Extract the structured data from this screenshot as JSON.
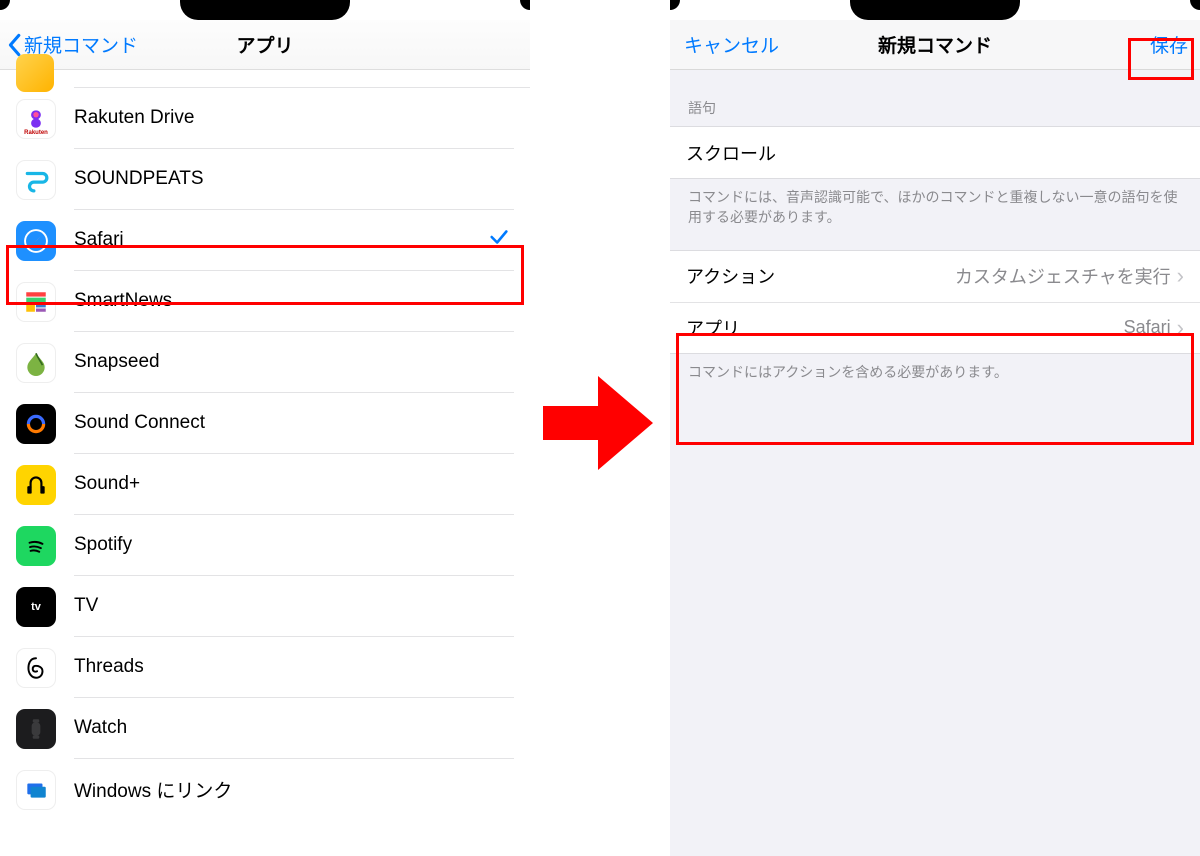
{
  "left": {
    "back_label": "新規コマンド",
    "title": "アプリ",
    "apps": [
      {
        "name": "Rakuten Drive",
        "icon": "rakuten-drive-icon",
        "selected": false
      },
      {
        "name": "SOUNDPEATS",
        "icon": "soundpeats-icon",
        "selected": false
      },
      {
        "name": "Safari",
        "icon": "safari-icon",
        "selected": true
      },
      {
        "name": "SmartNews",
        "icon": "smartnews-icon",
        "selected": false
      },
      {
        "name": "Snapseed",
        "icon": "snapseed-icon",
        "selected": false
      },
      {
        "name": "Sound Connect",
        "icon": "soundconnect-icon",
        "selected": false
      },
      {
        "name": "Sound+",
        "icon": "soundplus-icon",
        "selected": false
      },
      {
        "name": "Spotify",
        "icon": "spotify-icon",
        "selected": false
      },
      {
        "name": "TV",
        "icon": "tv-icon",
        "selected": false
      },
      {
        "name": "Threads",
        "icon": "threads-icon",
        "selected": false
      },
      {
        "name": "Watch",
        "icon": "watch-icon",
        "selected": false
      },
      {
        "name": "Windows にリンク",
        "icon": "windowslink-icon",
        "selected": false
      }
    ]
  },
  "right": {
    "cancel_label": "キャンセル",
    "title": "新規コマンド",
    "save_label": "保存",
    "section_phrase_header": "語句",
    "phrase_value": "スクロール",
    "phrase_footer": "コマンドには、音声認識可能で、ほかのコマンドと重複しない一意の語句を使用する必要があります。",
    "action_label": "アクション",
    "action_value": "カスタムジェスチャを実行",
    "app_label": "アプリ",
    "app_value": "Safari",
    "action_footer": "コマンドにはアクションを含める必要があります。"
  },
  "colors": {
    "ios_blue": "#007aff",
    "highlight_red": "#ff0000"
  }
}
